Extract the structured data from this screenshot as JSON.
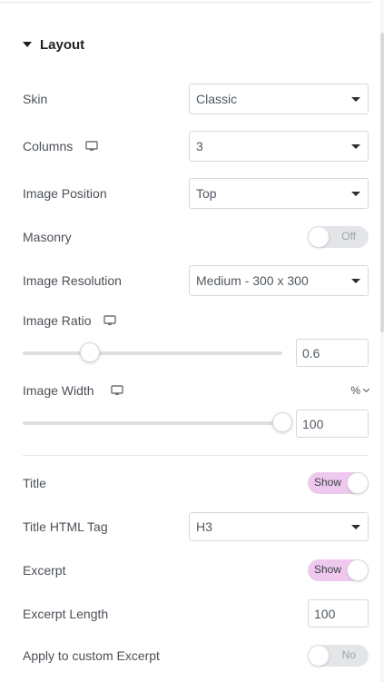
{
  "section": {
    "title": "Layout",
    "caret_icon": "caret-down-icon",
    "expanded": true
  },
  "controls": {
    "skin": {
      "label": "Skin",
      "value": "Classic"
    },
    "columns": {
      "label": "Columns",
      "value": "3",
      "device_icon": "desktop-icon"
    },
    "image_position": {
      "label": "Image Position",
      "value": "Top"
    },
    "masonry": {
      "label": "Masonry",
      "state": "Off"
    },
    "image_resolution": {
      "label": "Image Resolution",
      "value": "Medium - 300 x 300"
    },
    "image_ratio": {
      "label": "Image Ratio",
      "device_icon": "desktop-icon",
      "value": "0.6",
      "slider_fraction": 0.26
    },
    "image_width": {
      "label": "Image Width",
      "device_icon": "desktop-icon",
      "unit": "%",
      "value": "100",
      "slider_fraction": 1.0
    },
    "title": {
      "label": "Title",
      "state": "Show"
    },
    "title_html_tag": {
      "label": "Title HTML Tag",
      "value": "H3"
    },
    "excerpt": {
      "label": "Excerpt",
      "state": "Show"
    },
    "excerpt_length": {
      "label": "Excerpt Length",
      "value": "100"
    },
    "apply_custom_excerpt": {
      "label": "Apply to custom Excerpt",
      "state": "No"
    }
  },
  "colors": {
    "toggle_on": "#efc8ef",
    "toggle_off": "#e3e5e8",
    "heading": "#1f2124",
    "label": "#4b5057"
  }
}
